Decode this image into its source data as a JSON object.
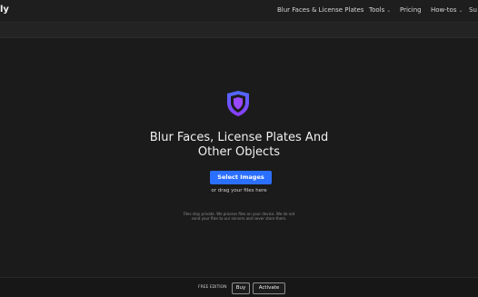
{
  "header": {
    "brand": "ly",
    "nav": [
      {
        "label": "Blur Faces & License Plates",
        "has_caret": false
      },
      {
        "label": "Tools",
        "has_caret": true
      },
      {
        "label": "Pricing",
        "has_caret": false
      },
      {
        "label": "How-tos",
        "has_caret": true
      },
      {
        "label": "Su",
        "has_caret": false
      }
    ]
  },
  "hero": {
    "icon": "shield-icon",
    "title_line1": "Blur Faces, License Plates And",
    "title_line2": "Other Objects",
    "select_button": "Select Images",
    "drag_text": "or drag your files here",
    "privacy_line1": "Files stay private. We process files on your device. We do not",
    "privacy_line2": "send your files to our servers and never store them."
  },
  "footer": {
    "edition": "FREE EDITION",
    "buy": "Buy",
    "activate": "Activate"
  },
  "colors": {
    "accent": "#2b6fff",
    "shield_outer": "#5b5cff",
    "shield_inner": "#9b45ff"
  }
}
